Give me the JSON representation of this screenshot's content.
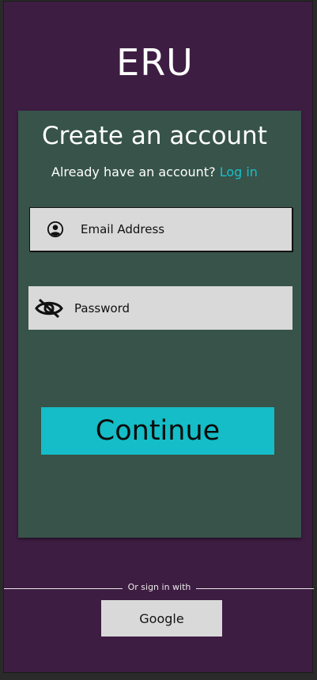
{
  "app": {
    "title": "ERU"
  },
  "card": {
    "title": "Create an account",
    "login_prompt": "Already have an account?",
    "login_link": "Log in"
  },
  "fields": {
    "email": {
      "label": "Email Address",
      "icon": "user-circle-icon"
    },
    "password": {
      "label": "Password",
      "icon": "eye-off-icon"
    }
  },
  "actions": {
    "continue_label": "Continue"
  },
  "social": {
    "divider_text": "Or sign in with",
    "google_label": "Google"
  },
  "colors": {
    "background": "#3e1d42",
    "card": "#37534a",
    "accent": "#14bdc7",
    "link": "#17c0cb",
    "field": "#d9d9d9"
  }
}
